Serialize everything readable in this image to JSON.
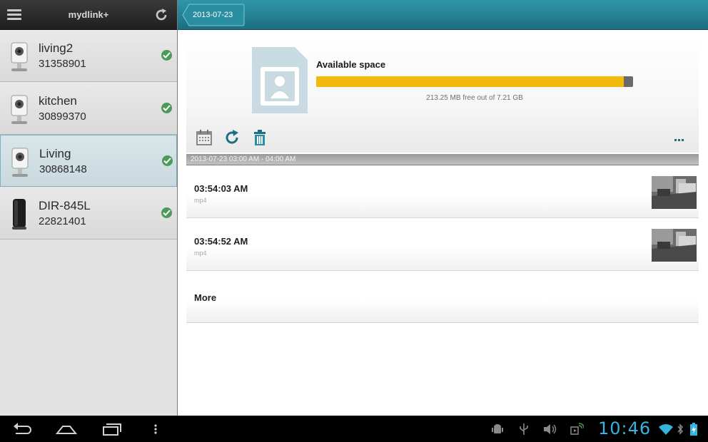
{
  "app": {
    "title": "mydlink+"
  },
  "devices": [
    {
      "name": "living2",
      "id": "31358901",
      "status": "online",
      "icon": "camera-icon"
    },
    {
      "name": "kitchen",
      "id": "30899370",
      "status": "online",
      "icon": "camera-icon"
    },
    {
      "name": "Living",
      "id": "30868148",
      "status": "online",
      "icon": "camera-icon",
      "selected": true
    },
    {
      "name": "DIR-845L",
      "id": "22821401",
      "status": "online",
      "icon": "router-icon"
    }
  ],
  "header": {
    "date": "2013-07-23"
  },
  "storage": {
    "label": "Available space",
    "free_text": "213.25 MB free out of 7.21 GB",
    "used_fraction": 0.97
  },
  "toolbar": {
    "icons": [
      "calendar-icon",
      "refresh-icon",
      "trash-icon",
      "more-icon"
    ]
  },
  "section": {
    "label": "2013-07-23 03:00 AM - 04:00 AM"
  },
  "clips": [
    {
      "time": "03:54:03 AM",
      "format": "mp4"
    },
    {
      "time": "03:54:52 AM",
      "format": "mp4"
    }
  ],
  "more_label": "More",
  "status_bar": {
    "clock": "10:46"
  },
  "colors": {
    "accent": "#1d6e80",
    "progress": "#f0bb0a",
    "online": "#4c9a59",
    "clock": "#35b4e0"
  }
}
